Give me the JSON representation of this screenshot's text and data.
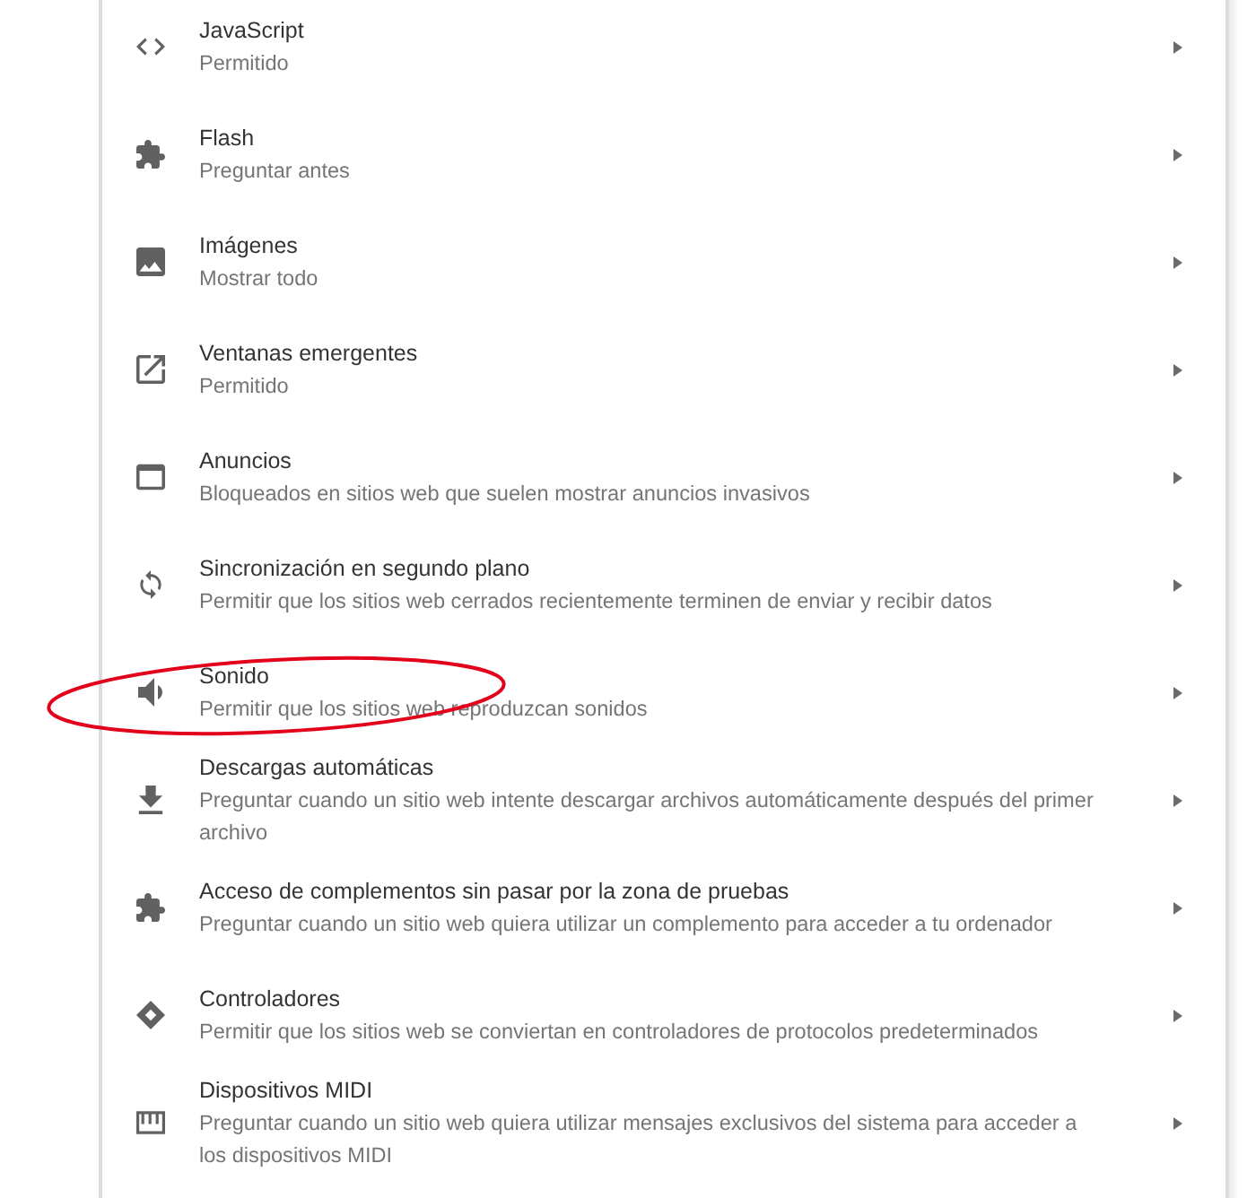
{
  "rows": [
    {
      "kind": "code",
      "title": "JavaScript",
      "subtitle": "Permitido",
      "circled": false
    },
    {
      "kind": "puzzle",
      "title": "Flash",
      "subtitle": "Preguntar antes",
      "circled": false
    },
    {
      "kind": "image",
      "title": "Imágenes",
      "subtitle": "Mostrar todo",
      "circled": false
    },
    {
      "kind": "popup",
      "title": "Ventanas emergentes",
      "subtitle": "Permitido",
      "circled": false
    },
    {
      "kind": "window",
      "title": "Anuncios",
      "subtitle": "Bloqueados en sitios web que suelen mostrar anuncios invasivos",
      "circled": false
    },
    {
      "kind": "sync",
      "title": "Sincronización en segundo plano",
      "subtitle": "Permitir que los sitios web cerrados recientemente terminen de enviar y recibir datos",
      "circled": false
    },
    {
      "kind": "sound",
      "title": "Sonido",
      "subtitle": "Permitir que los sitios web reproduzcan sonidos",
      "circled": true
    },
    {
      "kind": "download",
      "title": "Descargas automáticas",
      "subtitle": "Preguntar cuando un sitio web intente descargar archivos automáticamente después del primer archivo",
      "circled": false
    },
    {
      "kind": "puzzle",
      "title": "Acceso de complementos sin pasar por la zona de pruebas",
      "subtitle": "Preguntar cuando un sitio web quiera utilizar un complemento para acceder a tu ordenador",
      "circled": false
    },
    {
      "kind": "diamond",
      "title": "Controladores",
      "subtitle": "Permitir que los sitios web se conviertan en controladores de protocolos predeterminados",
      "circled": false
    },
    {
      "kind": "piano",
      "title": "Dispositivos MIDI",
      "subtitle": "Preguntar cuando un sitio web quiera utilizar mensajes exclusivos del sistema para acceder a los dispositivos MIDI",
      "circled": false
    }
  ]
}
